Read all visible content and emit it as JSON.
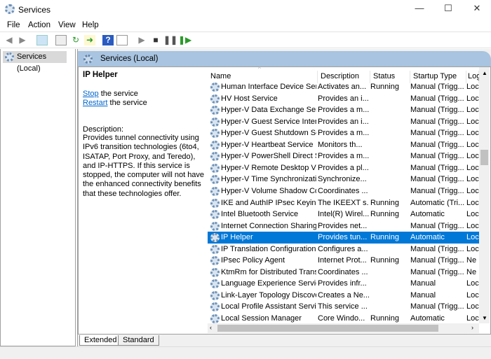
{
  "window": {
    "title": "Services",
    "minimize": "—",
    "maximize": "☐",
    "close": "✕"
  },
  "menu": [
    "File",
    "Action",
    "View",
    "Help"
  ],
  "toolbar": {
    "icons": [
      "back-icon",
      "forward-icon",
      "show-hide-console-tree-icon",
      "properties-icon",
      "refresh-icon",
      "export-list-icon",
      "help-icon",
      "show-action-pane-icon",
      "start-service-icon",
      "stop-service-icon",
      "pause-service-icon",
      "restart-service-icon"
    ]
  },
  "tree": {
    "item": "Services (Local)"
  },
  "pane": {
    "title": "Services (Local)"
  },
  "detail": {
    "service_name": "IP Helper",
    "stop_link": "Stop",
    "stop_suffix": " the service",
    "restart_link": "Restart",
    "restart_suffix": " the service",
    "description_label": "Description:",
    "description": "Provides tunnel connectivity using IPv6 transition technologies (6to4, ISATAP, Port Proxy, and Teredo), and IP-HTTPS. If this service is stopped, the computer will not have the enhanced connectivity benefits that these technologies offer."
  },
  "columns": [
    "Name",
    "Description",
    "Status",
    "Startup Type",
    "Log"
  ],
  "rows": [
    [
      "Human Interface Device Serv...",
      "Activates an...",
      "Running",
      "Manual (Trigg...",
      "Loc"
    ],
    [
      "HV Host Service",
      "Provides an i...",
      "",
      "Manual (Trigg...",
      "Loc"
    ],
    [
      "Hyper-V Data Exchange Serv...",
      "Provides a m...",
      "",
      "Manual (Trigg...",
      "Loc"
    ],
    [
      "Hyper-V Guest Service Interf...",
      "Provides an i...",
      "",
      "Manual (Trigg...",
      "Loc"
    ],
    [
      "Hyper-V Guest Shutdown Se...",
      "Provides a m...",
      "",
      "Manual (Trigg...",
      "Loc"
    ],
    [
      "Hyper-V Heartbeat Service",
      "Monitors th...",
      "",
      "Manual (Trigg...",
      "Loc"
    ],
    [
      "Hyper-V PowerShell Direct S...",
      "Provides a m...",
      "",
      "Manual (Trigg...",
      "Loc"
    ],
    [
      "Hyper-V Remote Desktop Vi...",
      "Provides a pl...",
      "",
      "Manual (Trigg...",
      "Loc"
    ],
    [
      "Hyper-V Time Synchronizati...",
      "Synchronize...",
      "",
      "Manual (Trigg...",
      "Loc"
    ],
    [
      "Hyper-V Volume Shadow Co...",
      "Coordinates ...",
      "",
      "Manual (Trigg...",
      "Loc"
    ],
    [
      "IKE and AuthIP IPsec Keying ...",
      "The IKEEXT s...",
      "Running",
      "Automatic (Tri...",
      "Loc"
    ],
    [
      "Intel Bluetooth Service",
      "Intel(R) Wirel...",
      "Running",
      "Automatic",
      "Loc"
    ],
    [
      "Internet Connection Sharing...",
      "Provides net...",
      "",
      "Manual (Trigg...",
      "Loc"
    ],
    [
      "IP Helper",
      "Provides tun...",
      "Running",
      "Automatic",
      "Loc"
    ],
    [
      "IP Translation Configuration ...",
      "Configures a...",
      "",
      "Manual (Trigg...",
      "Loc"
    ],
    [
      "IPsec Policy Agent",
      "Internet Prot...",
      "Running",
      "Manual (Trigg...",
      "Ne"
    ],
    [
      "KtmRm for Distributed Trans...",
      "Coordinates ...",
      "",
      "Manual (Trigg...",
      "Ne"
    ],
    [
      "Language Experience Service",
      "Provides infr...",
      "",
      "Manual",
      "Loc"
    ],
    [
      "Link-Layer Topology Discove...",
      "Creates a Ne...",
      "",
      "Manual",
      "Loc"
    ],
    [
      "Local Profile Assistant Service",
      "This service ...",
      "",
      "Manual (Trigg...",
      "Loc"
    ],
    [
      "Local Session Manager",
      "Core Windo...",
      "Running",
      "Automatic",
      "Loc"
    ]
  ],
  "selected_row": 13,
  "tabs": [
    "Extended",
    "Standard"
  ],
  "active_tab": "Extended",
  "colors": {
    "selection": "#0078d7",
    "header_bar": "#a8c4e0"
  }
}
